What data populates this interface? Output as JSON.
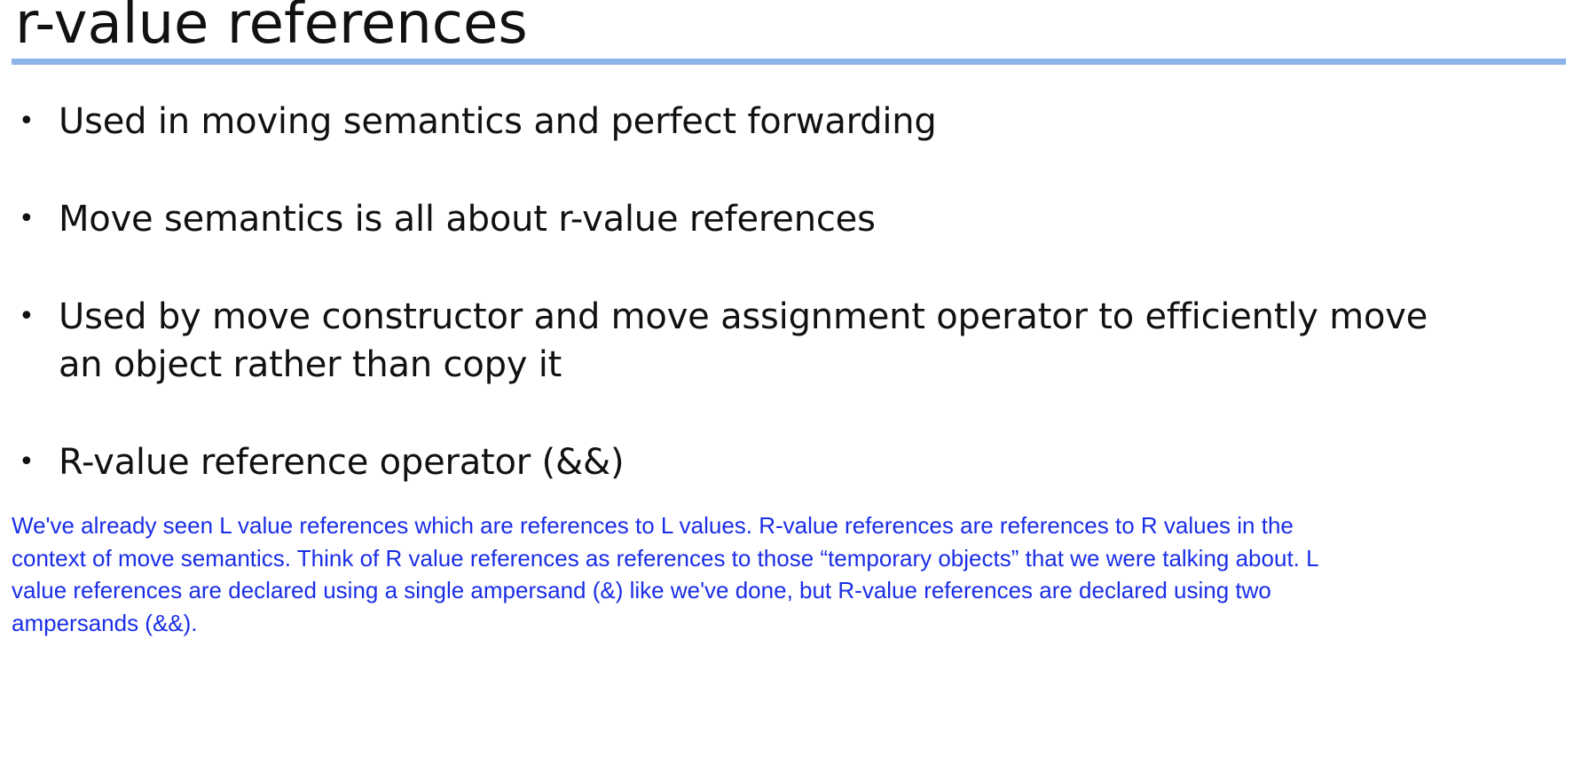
{
  "slide": {
    "title": "r-value references",
    "accent_color": "#8db5ea",
    "bullet_symbol": "•",
    "bullets": [
      {
        "lines": [
          "Used in moving semantics and perfect forwarding"
        ]
      },
      {
        "lines": [
          "Move semantics is all about r-value references"
        ]
      },
      {
        "lines": [
          "Used by move constructor and move assignment operator to efficiently move",
          "an object rather than copy it"
        ]
      },
      {
        "lines": [
          "R-value reference operator (&&)"
        ]
      }
    ]
  },
  "notes": {
    "color": "#1a2ee6",
    "lines": [
      "We've already seen L value references which are references to L values. R-value references are references to R values in the",
      "context of move semantics. Think of R value references as references to those “temporary objects” that we were talking about. L",
      "value references are declared using a single ampersand (&) like we've done, but R-value references are declared using two",
      "ampersands (&&)."
    ]
  }
}
